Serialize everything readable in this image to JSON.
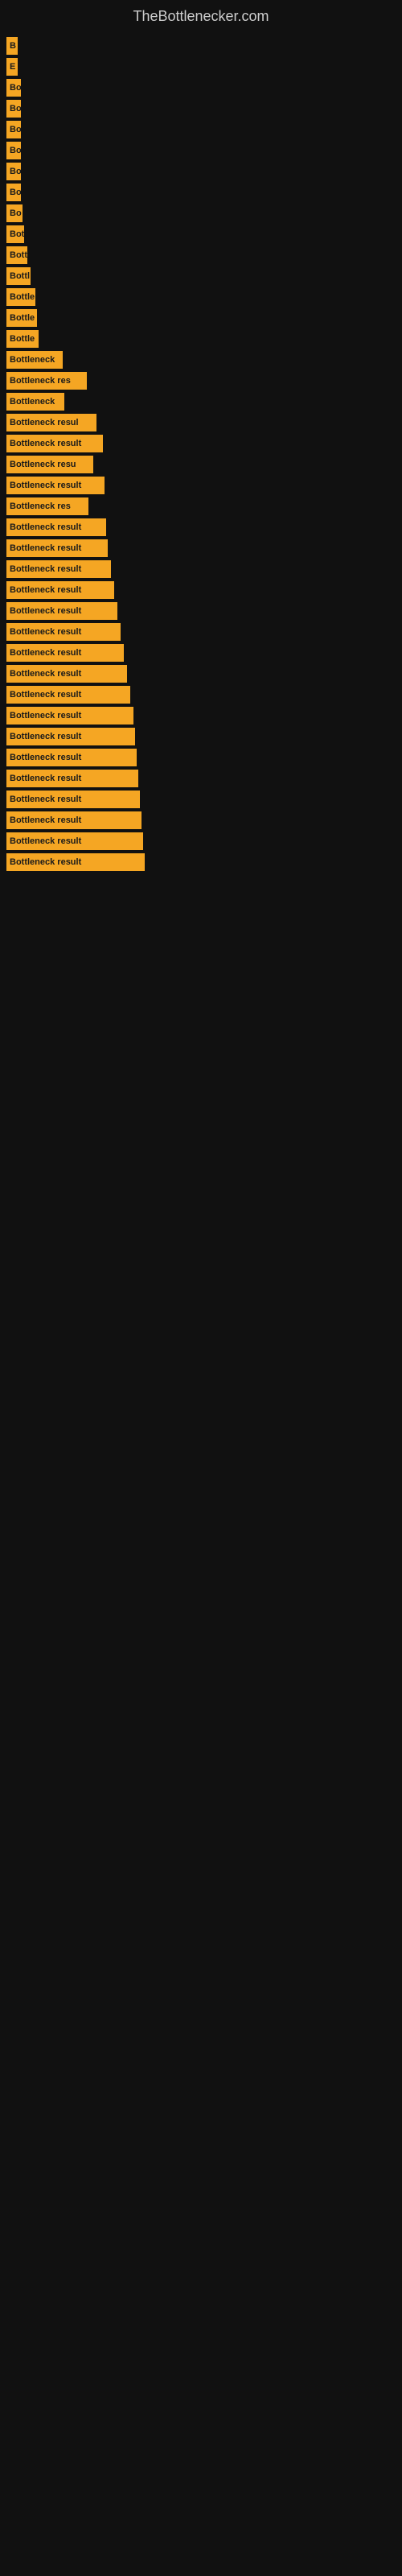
{
  "site": {
    "title": "TheBottlenecker.com"
  },
  "bars": [
    {
      "label": "B",
      "width": 14,
      "row": 1
    },
    {
      "label": "E",
      "width": 14,
      "row": 2
    },
    {
      "label": "Bo",
      "width": 18,
      "row": 3
    },
    {
      "label": "Bo",
      "width": 18,
      "row": 4
    },
    {
      "label": "Bo",
      "width": 18,
      "row": 5
    },
    {
      "label": "Bo",
      "width": 18,
      "row": 6
    },
    {
      "label": "Bo",
      "width": 18,
      "row": 7
    },
    {
      "label": "Bo",
      "width": 18,
      "row": 8
    },
    {
      "label": "Bo",
      "width": 20,
      "row": 9
    },
    {
      "label": "Bot",
      "width": 22,
      "row": 10
    },
    {
      "label": "Bott",
      "width": 26,
      "row": 11
    },
    {
      "label": "Bottl",
      "width": 30,
      "row": 12
    },
    {
      "label": "Bottle",
      "width": 36,
      "row": 13
    },
    {
      "label": "Bottle",
      "width": 38,
      "row": 14
    },
    {
      "label": "Bottle",
      "width": 40,
      "row": 15
    },
    {
      "label": "Bottleneck",
      "width": 70,
      "row": 16
    },
    {
      "label": "Bottleneck res",
      "width": 100,
      "row": 17
    },
    {
      "label": "Bottleneck",
      "width": 72,
      "row": 18
    },
    {
      "label": "Bottleneck resul",
      "width": 112,
      "row": 19
    },
    {
      "label": "Bottleneck result",
      "width": 120,
      "row": 20
    },
    {
      "label": "Bottleneck resu",
      "width": 108,
      "row": 21
    },
    {
      "label": "Bottleneck result",
      "width": 122,
      "row": 22
    },
    {
      "label": "Bottleneck res",
      "width": 102,
      "row": 23
    },
    {
      "label": "Bottleneck result",
      "width": 124,
      "row": 24
    },
    {
      "label": "Bottleneck result",
      "width": 126,
      "row": 25
    },
    {
      "label": "Bottleneck result",
      "width": 130,
      "row": 26
    },
    {
      "label": "Bottleneck result",
      "width": 134,
      "row": 27
    },
    {
      "label": "Bottleneck result",
      "width": 138,
      "row": 28
    },
    {
      "label": "Bottleneck result",
      "width": 142,
      "row": 29
    },
    {
      "label": "Bottleneck result",
      "width": 146,
      "row": 30
    },
    {
      "label": "Bottleneck result",
      "width": 150,
      "row": 31
    },
    {
      "label": "Bottleneck result",
      "width": 154,
      "row": 32
    },
    {
      "label": "Bottleneck result",
      "width": 158,
      "row": 33
    },
    {
      "label": "Bottleneck result",
      "width": 160,
      "row": 34
    },
    {
      "label": "Bottleneck result",
      "width": 162,
      "row": 35
    },
    {
      "label": "Bottleneck result",
      "width": 164,
      "row": 36
    },
    {
      "label": "Bottleneck result",
      "width": 166,
      "row": 37
    },
    {
      "label": "Bottleneck result",
      "width": 168,
      "row": 38
    },
    {
      "label": "Bottleneck result",
      "width": 170,
      "row": 39
    },
    {
      "label": "Bottleneck result",
      "width": 172,
      "row": 40
    }
  ]
}
